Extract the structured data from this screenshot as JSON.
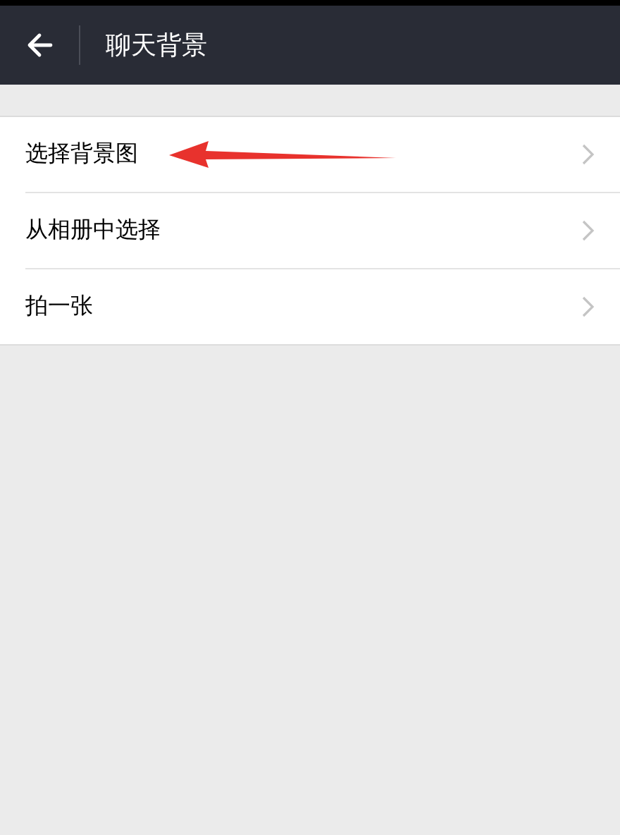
{
  "header": {
    "title": "聊天背景"
  },
  "items": [
    {
      "label": "选择背景图",
      "annotated": true
    },
    {
      "label": "从相册中选择",
      "annotated": false
    },
    {
      "label": "拍一张",
      "annotated": false
    }
  ]
}
